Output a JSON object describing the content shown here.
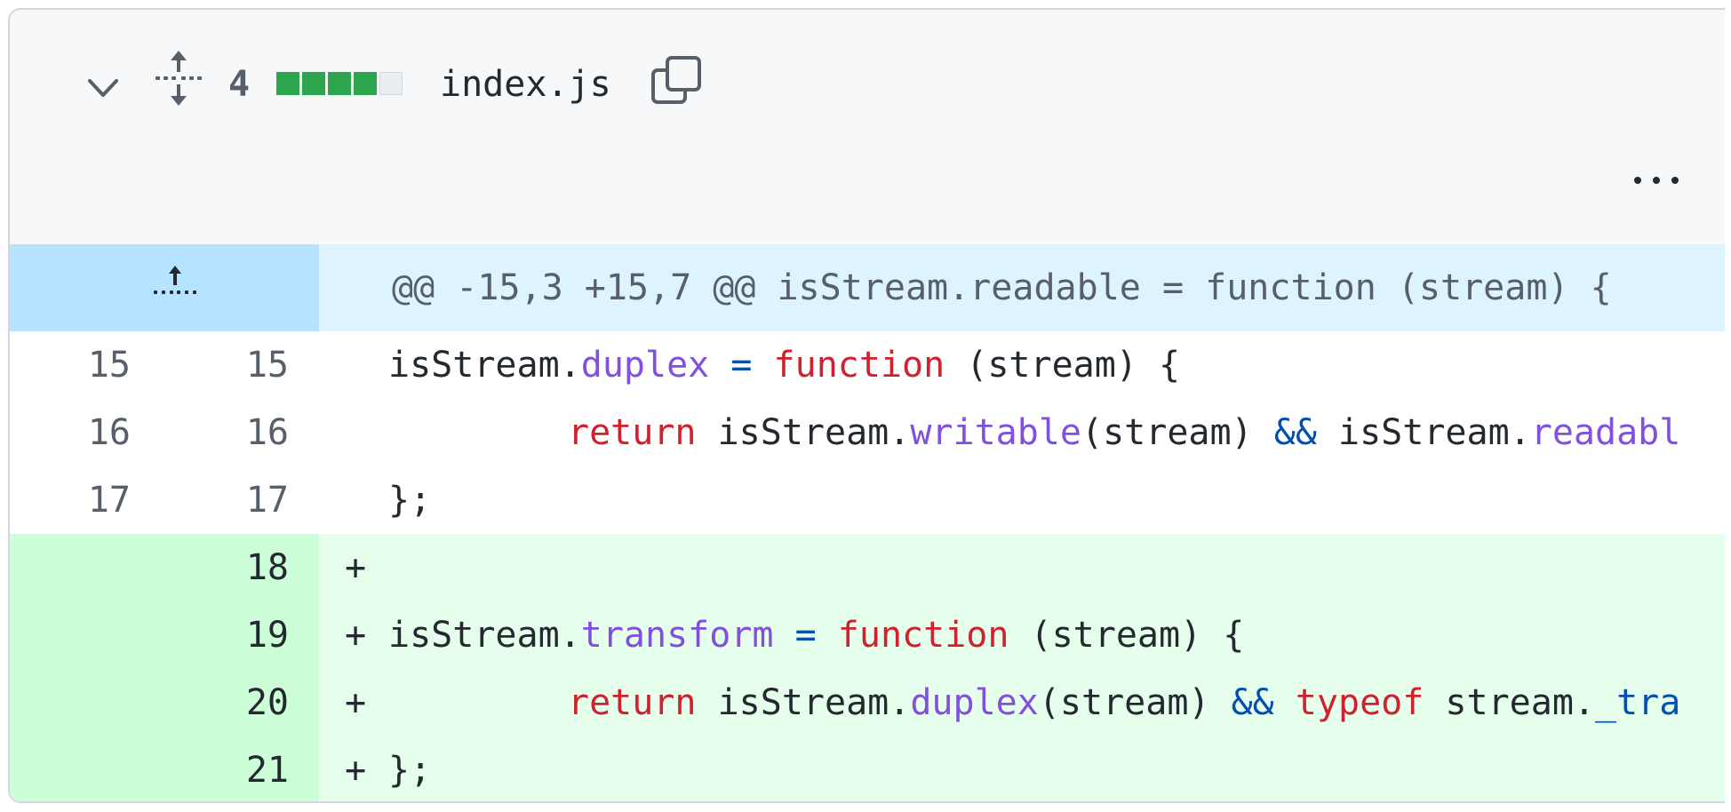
{
  "file": {
    "name": "index.js",
    "changes": "4",
    "diffstat": [
      "add",
      "add",
      "add",
      "add",
      "neutral"
    ]
  },
  "hunk": {
    "header": "@@ -15,3 +15,7 @@ isStream.readable = function (stream) {"
  },
  "lines": [
    {
      "old": "15",
      "new": "15",
      "type": "context",
      "sign": ""
    },
    {
      "old": "16",
      "new": "16",
      "type": "context",
      "sign": ""
    },
    {
      "old": "17",
      "new": "17",
      "type": "context",
      "sign": ""
    },
    {
      "old": "",
      "new": "18",
      "type": "addition",
      "sign": "+"
    },
    {
      "old": "",
      "new": "19",
      "type": "addition",
      "sign": "+"
    },
    {
      "old": "",
      "new": "20",
      "type": "addition",
      "sign": "+"
    },
    {
      "old": "",
      "new": "21",
      "type": "addition",
      "sign": "+"
    }
  ],
  "tokens": {
    "l15": [
      "isStream.",
      "duplex",
      " ",
      "=",
      " ",
      "function",
      " (stream) {"
    ],
    "l16": [
      "return",
      " isStream.",
      "writable",
      "(stream) ",
      "&&",
      " isStream.",
      "readabl"
    ],
    "l17": [
      "};"
    ],
    "l19": [
      "isStream.",
      "transform",
      " ",
      "=",
      " ",
      "function",
      " (stream) {"
    ],
    "l20": [
      "return",
      " isStream.",
      "duplex",
      "(stream) ",
      "&&",
      " ",
      "typeof",
      " stream.",
      "_tra"
    ],
    "l21": [
      "};"
    ]
  },
  "colors": {
    "addition_bg": "#e6ffec",
    "addition_gutter": "#ccffd8",
    "hunk_bg": "#ddf4ff",
    "hunk_gutter": "#b6e3ff",
    "diffstat_add": "#2da44e"
  }
}
